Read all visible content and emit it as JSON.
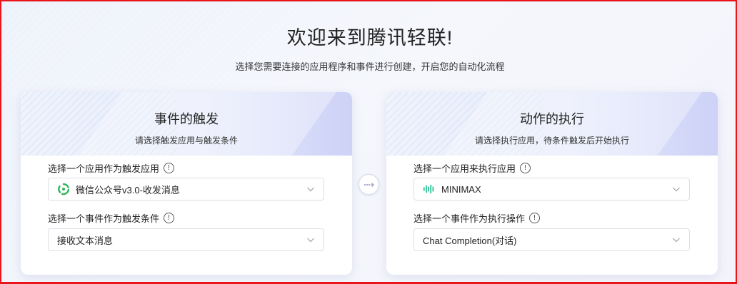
{
  "page": {
    "title": "欢迎来到腾讯轻联!",
    "subtitle": "选择您需要连接的应用程序和事件进行创建，开启您的自动化流程"
  },
  "trigger": {
    "title": "事件的触发",
    "subtitle": "请选择触发应用与触发条件",
    "app_label": "选择一个应用作为触发应用",
    "app_value": "微信公众号v3.0-收发消息",
    "app_icon": "wechat-official-account-icon",
    "event_label": "选择一个事件作为触发条件",
    "event_value": "接收文本消息"
  },
  "connector": {
    "icon": "arrow-right-dotted-icon"
  },
  "action": {
    "title": "动作的执行",
    "subtitle": "请选择执行应用，待条件触发后开始执行",
    "app_label": "选择一个应用来执行应用",
    "app_value": "MINIMAX",
    "app_icon": "minimax-waveform-icon",
    "event_label": "选择一个事件作为执行操作",
    "event_value": "Chat Completion(对话)"
  },
  "colors": {
    "border_accent": "#e8151b",
    "wechat_green": "#2bb55a",
    "minimax_green": "#2fc39a",
    "header_purple": "#cdd2f7"
  },
  "info_glyph": "!"
}
